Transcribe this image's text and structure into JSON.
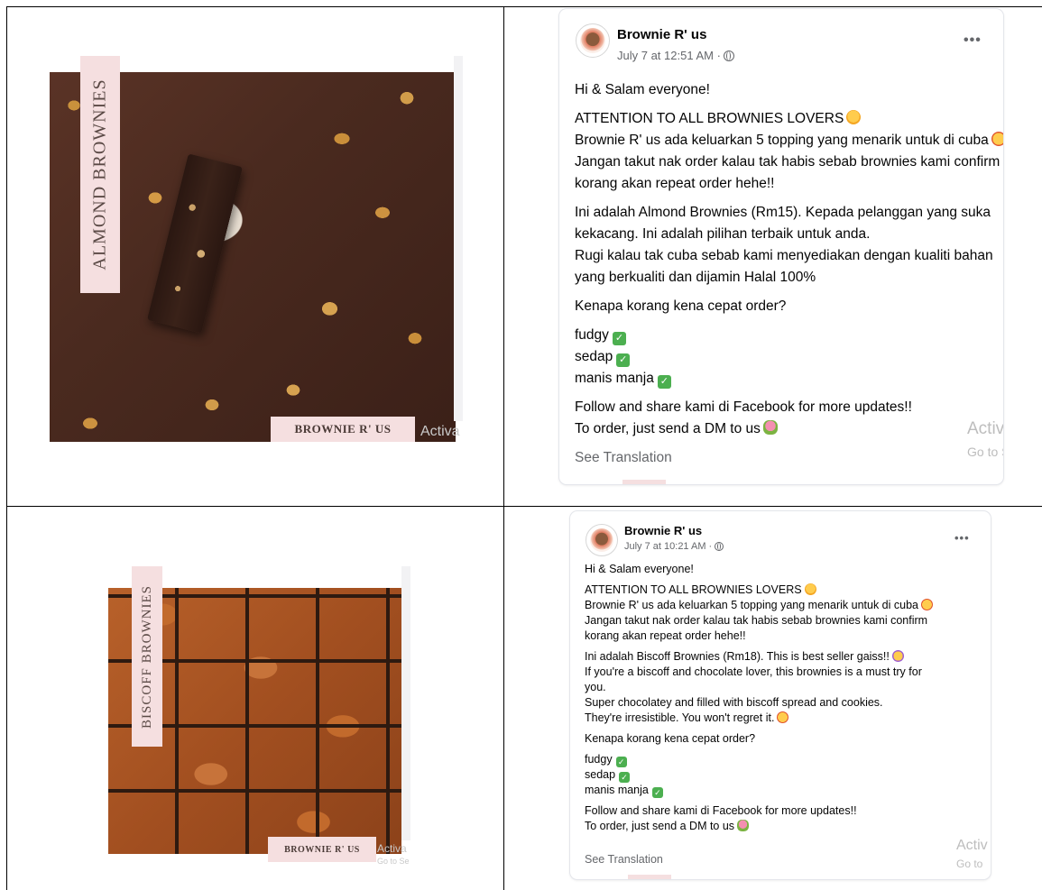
{
  "row1": {
    "image": {
      "vertical_title": "ALMOND BROWNIES",
      "brand_tag": "BROWNIE R' US",
      "watermark": "Activa"
    },
    "post": {
      "author": "Brownie R' us",
      "timestamp": "July 7 at 12:51 AM ·",
      "more_icon": "more-horizontal-icon",
      "lines": [
        "Hi & Salam everyone!",
        "ATTENTION TO ALL BROWNIES LOVERS",
        "Brownie R' us ada keluarkan 5 topping yang menarik untuk di cuba",
        "Jangan takut nak order kalau tak habis sebab brownies kami confirm",
        "korang akan repeat order hehe!!",
        "Ini adalah Almond Brownies (Rm15). Kepada pelanggan yang suka",
        "kekacang. Ini adalah pilihan terbaik untuk anda.",
        "Rugi kalau tak cuba sebab kami menyediakan dengan kualiti bahan",
        "yang berkualiti dan dijamin Halal 100%",
        "Kenapa korang kena cepat order?",
        "fudgy",
        "sedap",
        "manis manja",
        "Follow and share kami di Facebook for more updates!!",
        "To order, just send a DM to us"
      ],
      "see_translation": "See Translation",
      "watermark_line1": "Activ",
      "watermark_line2": "Go to S"
    }
  },
  "row2": {
    "image": {
      "vertical_title": "BISCOFF BROWNIES",
      "brand_tag": "BROWNIE R' US",
      "watermark": "Activa",
      "watermark_sub": "Go to Se"
    },
    "post": {
      "author": "Brownie R' us",
      "timestamp": "July 7 at 10:21 AM ·",
      "more_icon": "more-horizontal-icon",
      "lines": [
        "Hi & Salam everyone!",
        "ATTENTION TO ALL BROWNIES LOVERS",
        "Brownie R' us ada keluarkan 5 topping yang menarik untuk di cuba",
        "Jangan takut nak order kalau tak habis sebab brownies kami confirm",
        "korang akan repeat order hehe!!",
        "Ini adalah Biscoff Brownies (Rm18). This is best seller gaiss!!",
        "If you're a biscoff and chocolate lover, this brownies is a must try for",
        "you.",
        "Super chocolatey and filled with biscoff spread and cookies.",
        "They're irresistible. You won't regret it.",
        "Kenapa korang kena cepat order?",
        "fudgy",
        "sedap",
        "manis manja",
        "Follow and share kami di Facebook for more updates!!",
        "To order, just send a DM to us"
      ],
      "see_translation": "See Translation",
      "watermark_line1": "Activ",
      "watermark_line2": "Go to"
    }
  }
}
